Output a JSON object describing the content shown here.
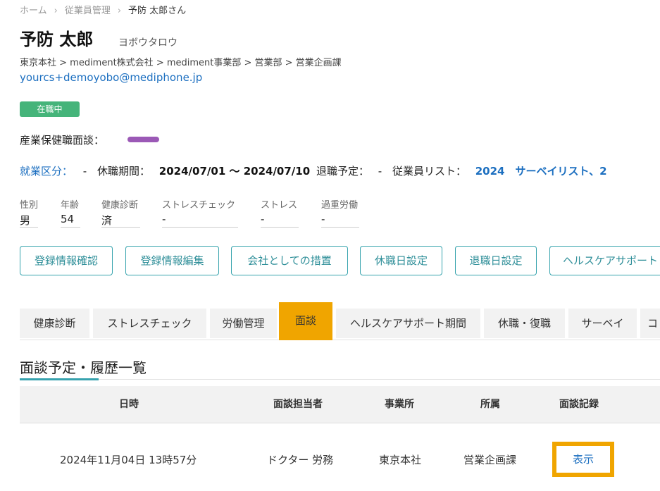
{
  "breadcrumb": [
    "ホーム",
    "従業員管理",
    "予防 太郎さん"
  ],
  "employee": {
    "name": "予防 太郎",
    "kana": "ヨボウタロウ",
    "org_path": "東京本社 > mediment株式会社 > mediment事業部 > 営業部 > 営業企画課",
    "email": "yourcs+demoyobo@mediphone.jp",
    "status_badge": "在職中",
    "status_color": "#45b47a",
    "oh_label": "産業保健職面談：",
    "oh_color": "#9b59b6"
  },
  "info": {
    "work_type_label": "就業区分：",
    "work_type_value": "-",
    "leave_label": "休職期間：",
    "leave_value": "2024/07/01 〜 2024/07/10",
    "retire_label": "退職予定：",
    "retire_value": "-",
    "list_label": "従業員リスト：",
    "list_value": "2024　サーベイリスト、2"
  },
  "fields": [
    {
      "label": "性別",
      "value": "男"
    },
    {
      "label": "年齢",
      "value": "54"
    },
    {
      "label": "健康診断",
      "value": "済"
    },
    {
      "label": "ストレスチェック",
      "value": "-"
    },
    {
      "label": "ストレス",
      "value": "-"
    },
    {
      "label": "過重労働",
      "value": "-"
    }
  ],
  "buttons": [
    "登録情報確認",
    "登録情報編集",
    "会社としての措置",
    "休職日設定",
    "退職日設定",
    "ヘルスケアサポート"
  ],
  "tabs": [
    "健康診断",
    "ストレスチェック",
    "労働管理",
    "面談",
    "ヘルスケアサポート期間",
    "休職・復職",
    "サーベイ",
    "コ"
  ],
  "section_title": "面談予定・履歴一覧",
  "table": {
    "headers": [
      "日時",
      "面談担当者",
      "事業所",
      "所属",
      "面談記録"
    ],
    "rows": [
      [
        "2024年11月04日 13時57分",
        "ドクター 労務",
        "東京本社",
        "営業企画課",
        "表示"
      ]
    ]
  },
  "colors": {
    "accent": "#37a2ae",
    "highlight": "#f0a500",
    "link": "#1c6fc0"
  }
}
